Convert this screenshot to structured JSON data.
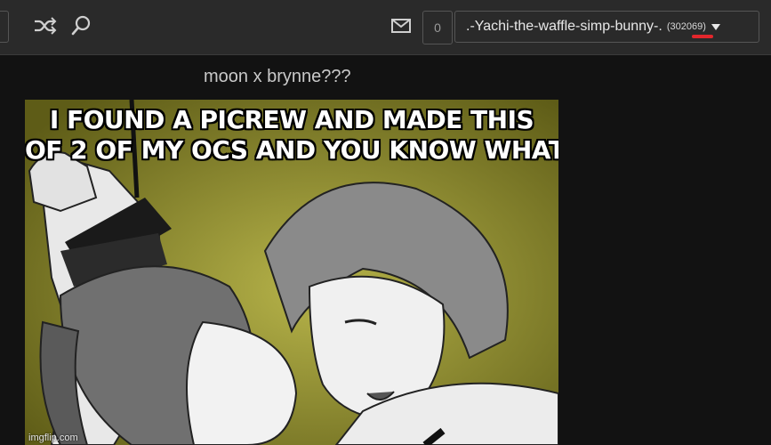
{
  "header": {
    "notification_count": "0",
    "username": ".-Yachi-the-waffle-simp-bunny-.",
    "points": "(302069)",
    "icons": {
      "shuffle": "shuffle-icon",
      "search": "search-icon",
      "mail": "mail-icon",
      "dropdown": "chevron-down-icon"
    },
    "colors": {
      "background": "#2a2a2a",
      "annotation": "#e3262c"
    }
  },
  "post": {
    "title": "moon x brynne???",
    "image": {
      "caption_line1": "I FOUND A PICREW AND MADE THIS",
      "caption_line2": "OF 2 OF MY OCS AND YOU KNOW WHAT?",
      "watermark": "imgflip.com"
    }
  }
}
